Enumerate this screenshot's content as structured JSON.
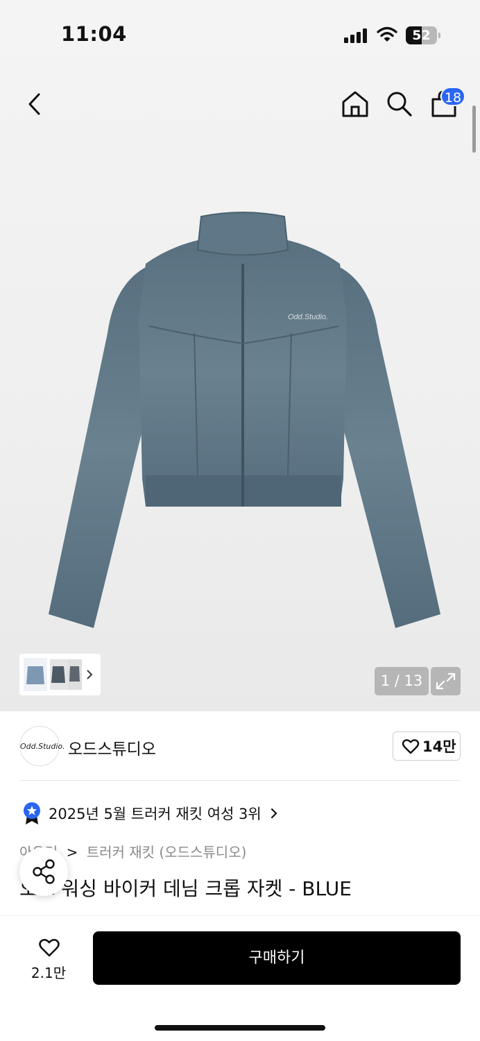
{
  "status_bar": {
    "time": "11:04",
    "battery": "52",
    "battery_level_percent": 52
  },
  "nav": {
    "cart_count": "18"
  },
  "gallery": {
    "counter": "1 / 13"
  },
  "brand": {
    "logo_text": "Odd.Studio.",
    "name": "오드스튜디오",
    "likes": "14만"
  },
  "ranking": {
    "text": "2025년 5월 트러커 재킷 여성 3위"
  },
  "breadcrumb": {
    "category": "아우터",
    "separator": ">",
    "subcategory": "트러커 재킷 (오드스튜디오)"
  },
  "product": {
    "title": "오드 워싱 바이커 데님 크롭 자켓 - BLUE",
    "jacket_logo_text": "Odd.Studio."
  },
  "bottom_bar": {
    "wish_count": "2.1만",
    "buy_label": "구매하기"
  },
  "colors": {
    "badge_blue": "#2a66f2",
    "denim": "#5a7283",
    "button_black": "#000000"
  },
  "icons": [
    "back-chevron-icon",
    "home-icon",
    "search-icon",
    "shopping-bag-icon",
    "expand-icon",
    "heart-icon",
    "share-icon",
    "rank-badge-icon",
    "chevron-right-icon"
  ]
}
